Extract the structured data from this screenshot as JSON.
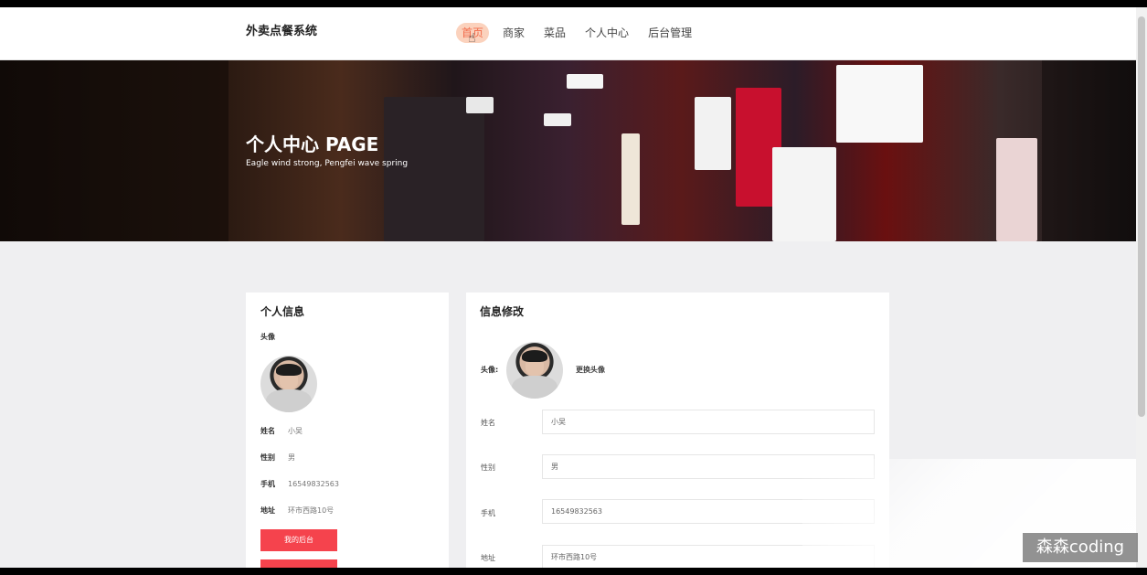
{
  "header": {
    "logo": "外卖点餐系统",
    "nav": [
      "首页",
      "商家",
      "菜品",
      "个人中心",
      "后台管理"
    ]
  },
  "banner": {
    "title": "个人中心 PAGE",
    "subtitle": "Eagle wind strong, Pengfei wave spring"
  },
  "profile": {
    "title": "个人信息",
    "avatar_label": "头像",
    "fields": [
      {
        "label": "姓名",
        "value": "小吴"
      },
      {
        "label": "性别",
        "value": "男"
      },
      {
        "label": "手机",
        "value": "16549832563"
      },
      {
        "label": "地址",
        "value": "环市西路10号"
      }
    ],
    "backend_button": "我的后台"
  },
  "edit": {
    "title": "信息修改",
    "avatar_label": "头像:",
    "change_avatar": "更换头像",
    "fields": [
      {
        "label": "姓名",
        "value": "小吴"
      },
      {
        "label": "性别",
        "value": "男"
      },
      {
        "label": "手机",
        "value": "16549832563"
      },
      {
        "label": "地址",
        "value": "环市西路10号"
      }
    ]
  },
  "watermark": "森森coding",
  "colors": {
    "accent": "#f26b4a",
    "button": "#f5434d",
    "background": "#efeff1"
  }
}
